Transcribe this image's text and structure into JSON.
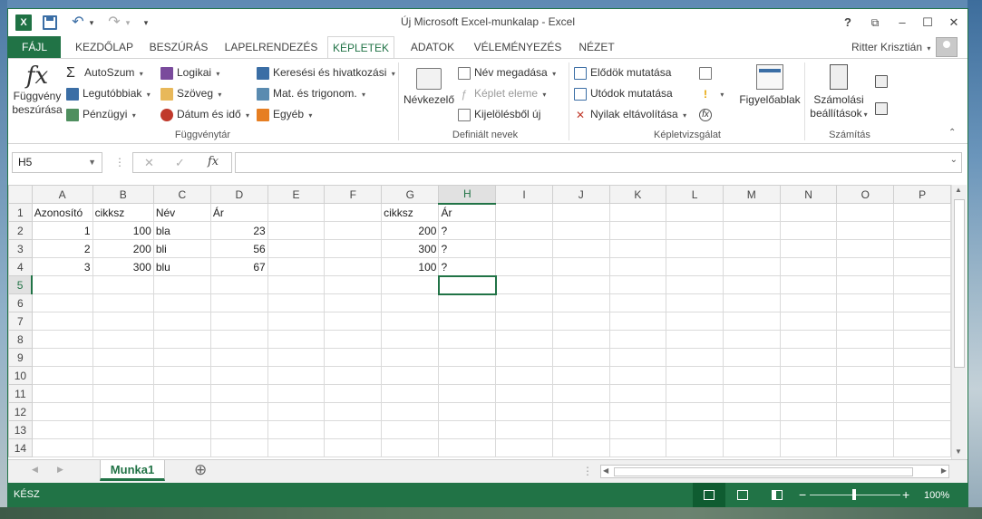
{
  "window": {
    "title": "Új Microsoft Excel-munkalap - Excel"
  },
  "app": {
    "logo": "X"
  },
  "window_controls": {
    "help": "?",
    "ribbon_display": "⧉",
    "minimize": "–",
    "maximize": "☐",
    "close": "✕"
  },
  "qat": {
    "undo": "↶",
    "redo": "↷",
    "customize": "▾"
  },
  "tabs": [
    {
      "label": "FÁJL"
    },
    {
      "label": "KEZDŐLAP"
    },
    {
      "label": "BESZÚRÁS"
    },
    {
      "label": "LAPELRENDEZÉS"
    },
    {
      "label": "KÉPLETEK"
    },
    {
      "label": "ADATOK"
    },
    {
      "label": "VÉLEMÉNYEZÉS"
    },
    {
      "label": "NÉZET"
    }
  ],
  "user": {
    "name": "Ritter Krisztián"
  },
  "ribbon": {
    "function_library": {
      "label": "Függvénytár",
      "insert_function": {
        "line1": "Függvény",
        "line2": "beszúrása",
        "icon": "fx"
      },
      "autosum": "AutoSzum",
      "recent": "Legutóbbiak",
      "financial": "Pénzügyi",
      "logical": "Logikai",
      "text": "Szöveg",
      "datetime": "Dátum és idő",
      "lookup": "Keresési és hivatkozási",
      "math": "Mat. és trigonom.",
      "more": "Egyéb"
    },
    "defined_names": {
      "label": "Definiált nevek",
      "name_manager": "Névkezelő",
      "define_name": "Név megadása",
      "use_in_formula": "Képlet eleme",
      "create_from_selection": "Kijelölésből új"
    },
    "formula_auditing": {
      "label": "Képletvizsgálat",
      "trace_precedents": "Elődök mutatása",
      "trace_dependents": "Utódok mutatása",
      "remove_arrows": "Nyilak eltávolítása",
      "watch_window": "Figyelőablak"
    },
    "calculation": {
      "label": "Számítás",
      "options_line1": "Számolási",
      "options_line2": "beállítások"
    }
  },
  "formula_bar": {
    "name_box": "H5",
    "cancel": "✕",
    "enter": "✓",
    "fx": "fx",
    "value": ""
  },
  "sheet": {
    "columns": [
      "A",
      "B",
      "C",
      "D",
      "E",
      "F",
      "G",
      "H",
      "I",
      "J",
      "K",
      "L",
      "M",
      "N",
      "O",
      "P"
    ],
    "rows": [
      [
        "Azonosító",
        "cikksz",
        "Név",
        "Ár",
        "",
        "",
        "cikksz",
        "Ár",
        "",
        "",
        "",
        "",
        "",
        "",
        "",
        ""
      ],
      [
        "1",
        "100",
        "bla",
        "23",
        "",
        "",
        "200",
        "?",
        "",
        "",
        "",
        "",
        "",
        "",
        "",
        ""
      ],
      [
        "2",
        "200",
        "bli",
        "56",
        "",
        "",
        "300",
        "?",
        "",
        "",
        "",
        "",
        "",
        "",
        "",
        ""
      ],
      [
        "3",
        "300",
        "blu",
        "67",
        "",
        "",
        "100",
        "?",
        "",
        "",
        "",
        "",
        "",
        "",
        "",
        ""
      ],
      [
        "",
        "",
        "",
        "",
        "",
        "",
        "",
        "",
        "",
        "",
        "",
        "",
        "",
        "",
        "",
        ""
      ],
      [
        "",
        "",
        "",
        "",
        "",
        "",
        "",
        "",
        "",
        "",
        "",
        "",
        "",
        "",
        "",
        ""
      ],
      [
        "",
        "",
        "",
        "",
        "",
        "",
        "",
        "",
        "",
        "",
        "",
        "",
        "",
        "",
        "",
        ""
      ],
      [
        "",
        "",
        "",
        "",
        "",
        "",
        "",
        "",
        "",
        "",
        "",
        "",
        "",
        "",
        "",
        ""
      ],
      [
        "",
        "",
        "",
        "",
        "",
        "",
        "",
        "",
        "",
        "",
        "",
        "",
        "",
        "",
        "",
        ""
      ],
      [
        "",
        "",
        "",
        "",
        "",
        "",
        "",
        "",
        "",
        "",
        "",
        "",
        "",
        "",
        "",
        ""
      ],
      [
        "",
        "",
        "",
        "",
        "",
        "",
        "",
        "",
        "",
        "",
        "",
        "",
        "",
        "",
        "",
        ""
      ],
      [
        "",
        "",
        "",
        "",
        "",
        "",
        "",
        "",
        "",
        "",
        "",
        "",
        "",
        "",
        "",
        ""
      ],
      [
        "",
        "",
        "",
        "",
        "",
        "",
        "",
        "",
        "",
        "",
        "",
        "",
        "",
        "",
        "",
        ""
      ],
      [
        "",
        "",
        "",
        "",
        "",
        "",
        "",
        "",
        "",
        "",
        "",
        "",
        "",
        "",
        "",
        ""
      ]
    ],
    "numeric_cells": [
      "A2",
      "B2",
      "D2",
      "G2",
      "A3",
      "B3",
      "D3",
      "G3",
      "A4",
      "B4",
      "D4",
      "G4"
    ],
    "active_cell": "H5"
  },
  "sheet_tabs": [
    {
      "label": "Munka1"
    }
  ],
  "sheet_nav": {
    "prev": "◀",
    "next": "▶",
    "add": "⊕"
  },
  "status": {
    "mode": "KÉSZ",
    "zoom": "100%",
    "zoom_minus": "−",
    "zoom_plus": "+"
  },
  "colors": {
    "accent": "#217346"
  }
}
